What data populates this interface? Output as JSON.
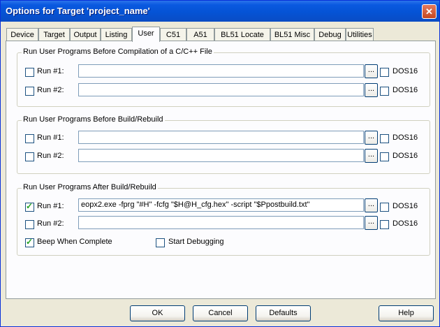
{
  "window": {
    "title": "Options for Target 'project_name'",
    "close_glyph": "✕"
  },
  "tabs": [
    "Device",
    "Target",
    "Output",
    "Listing",
    "User",
    "C51",
    "A51",
    "BL51 Locate",
    "BL51 Misc",
    "Debug",
    "Utilities"
  ],
  "active_tab": "User",
  "groups": {
    "before_compile": {
      "title": "Run User Programs Before Compilation of a C/C++ File",
      "run1": {
        "label": "Run #1:",
        "checked": false,
        "value": "",
        "dos16": "DOS16"
      },
      "run2": {
        "label": "Run #2:",
        "checked": false,
        "value": "",
        "dos16": "DOS16"
      }
    },
    "before_build": {
      "title": "Run User Programs Before Build/Rebuild",
      "run1": {
        "label": "Run #1:",
        "checked": false,
        "value": "",
        "dos16": "DOS16"
      },
      "run2": {
        "label": "Run #2:",
        "checked": false,
        "value": "",
        "dos16": "DOS16"
      }
    },
    "after_build": {
      "title": "Run User Programs After Build/Rebuild",
      "run1": {
        "label": "Run #1:",
        "checked": true,
        "value": "eopx2.exe -fprg \"#H\" -fcfg \"$H@H_cfg.hex\" -script \"$Ppostbuild.txt\"",
        "dos16": "DOS16"
      },
      "run2": {
        "label": "Run #2:",
        "checked": false,
        "value": "",
        "dos16": "DOS16"
      },
      "beep": {
        "label": "Beep When Complete",
        "checked": true
      },
      "start_debug": {
        "label": "Start Debugging",
        "checked": false
      }
    }
  },
  "browse_label": "...",
  "buttons": {
    "ok": "OK",
    "cancel": "Cancel",
    "defaults": "Defaults",
    "help": "Help"
  }
}
